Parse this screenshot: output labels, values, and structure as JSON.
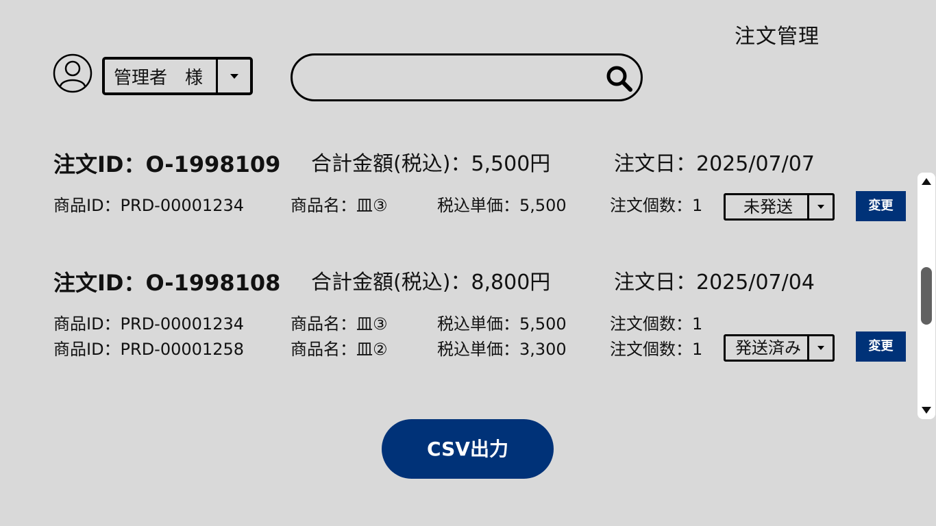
{
  "header": {
    "page_title": "注文管理",
    "user_label": "管理者　様",
    "search_value": "",
    "search_placeholder": ""
  },
  "orders": [
    {
      "id": "注文ID：O-1998109",
      "total": "合計金額(税込)：5,500円",
      "date": "注文日：2025/07/07",
      "items": [
        {
          "product_id": "商品ID：PRD-00001234",
          "name": "商品名：皿③",
          "price": "税込単価：5,500",
          "qty": "注文個数：1"
        }
      ],
      "status": "未発送",
      "change_label": "変更"
    },
    {
      "id": "注文ID：O-1998108",
      "total": "合計金額(税込)：8,800円",
      "date": "注文日：2025/07/04",
      "items": [
        {
          "product_id": "商品ID：PRD-00001234",
          "name": "商品名：皿③",
          "price": "税込単価：5,500",
          "qty": "注文個数：1"
        },
        {
          "product_id": "商品ID：PRD-00001258",
          "name": "商品名：皿②",
          "price": "税込単価：3,300",
          "qty": "注文個数：1"
        }
      ],
      "status": "発送済み",
      "change_label": "変更"
    }
  ],
  "footer": {
    "csv_label": "CSV出力"
  },
  "colors": {
    "background": "#d9d9d9",
    "accent": "#003278",
    "scroll_thumb": "#616161"
  },
  "icons": {
    "avatar": "user-circle-icon",
    "search": "search-icon",
    "dropdown": "caret-down-icon",
    "scroll_up": "scroll-up-arrow-icon",
    "scroll_down": "scroll-down-arrow-icon"
  }
}
